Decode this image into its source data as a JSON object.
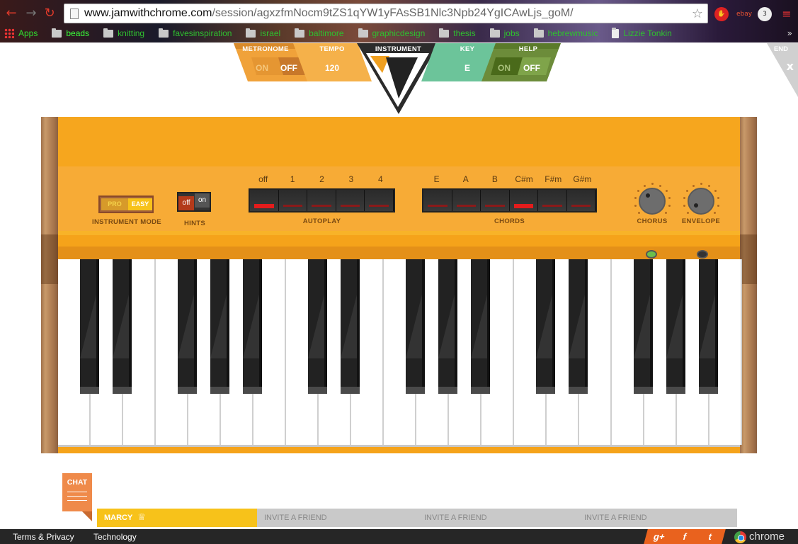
{
  "browser": {
    "url_host": "www.jamwithchrome.com",
    "url_path": "/session/agxzfmNocm9tZS1qYW1yFAsSB1Nlc3Npb24YgICAwLjs_goM/",
    "bookmarks": [
      "Apps",
      "beads",
      "knitting",
      "favesinspiration",
      "israel",
      "baltimore",
      "graphicdesign",
      "thesis",
      "jobs",
      "hebrewmusic",
      "Lizzie Tonkin"
    ]
  },
  "topbar": {
    "metronome": {
      "label": "METRONOME",
      "on": "ON",
      "off": "OFF"
    },
    "tempo": {
      "label": "TEMPO",
      "value": "120"
    },
    "instrument": {
      "label": "INSTRUMENT"
    },
    "key": {
      "label": "KEY",
      "value": "E"
    },
    "help": {
      "label": "HELP",
      "on": "ON",
      "off": "OFF"
    },
    "end": {
      "label": "END",
      "close": "x"
    }
  },
  "panel": {
    "mode": {
      "pro": "PRO",
      "easy": "EASY",
      "label": "INSTRUMENT MODE"
    },
    "hints": {
      "off": "off",
      "on": "on",
      "label": "HINTS"
    },
    "autoplay": {
      "label": "AUTOPLAY",
      "options": [
        "off",
        "1",
        "2",
        "3",
        "4"
      ],
      "active_index": 0
    },
    "chords": {
      "label": "CHORDS",
      "options": [
        "E",
        "A",
        "B",
        "C#m",
        "F#m",
        "G#m"
      ],
      "active_index": 3
    },
    "chorus": {
      "label": "CHORUS"
    },
    "envelope": {
      "label": "ENVELOPE"
    }
  },
  "chat": {
    "label": "CHAT"
  },
  "players": [
    "MARCY",
    "INVITE A FRIEND",
    "INVITE A FRIEND",
    "INVITE A FRIEND"
  ],
  "footer": {
    "terms": "Terms & Privacy",
    "technology": "Technology",
    "social": [
      "g+",
      "f",
      "t"
    ],
    "brand": "chrome"
  },
  "colors": {
    "accent": "#f6a61e",
    "led_active": "#e41c1c",
    "indicator_on": "#6abf4b"
  }
}
